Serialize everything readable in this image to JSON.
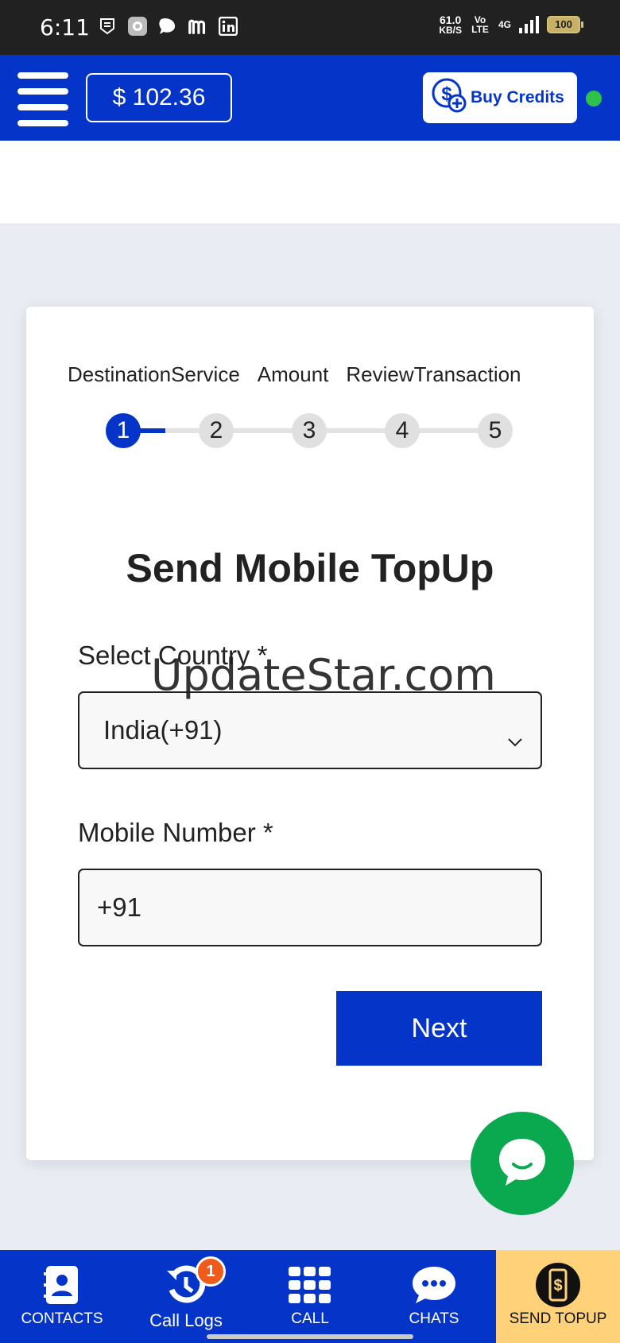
{
  "status_bar": {
    "time": "6:11",
    "network_speed": "61.0",
    "speed_unit": "KB/S",
    "volte": "Vo LTE",
    "network": "4G",
    "battery": "100"
  },
  "header": {
    "balance": "$ 102.36",
    "buy_credits_label": "Buy Credits",
    "accent_color": "#0534c9",
    "online_color": "#2ec24a"
  },
  "stepper": {
    "labels": [
      "Destination",
      "Service",
      "Amount",
      "Review",
      "Transaction"
    ],
    "steps": [
      "1",
      "2",
      "3",
      "4",
      "5"
    ],
    "active_step": 1
  },
  "form": {
    "title": "Send Mobile TopUp",
    "country_label": "Select Country *",
    "country_value": "India(+91)",
    "mobile_label": "Mobile Number *",
    "mobile_value": "+91",
    "next_label": "Next"
  },
  "watermark": "UpdateStar.com",
  "bottom_nav": {
    "items": [
      {
        "label": "CONTACTS",
        "icon": "contacts-icon"
      },
      {
        "label": "Call Logs",
        "icon": "call-logs-icon",
        "badge": "1"
      },
      {
        "label": "CALL",
        "icon": "dialpad-icon"
      },
      {
        "label": "CHATS",
        "icon": "chat-bubble-icon"
      },
      {
        "label": "SEND TOPUP",
        "icon": "send-topup-icon"
      }
    ],
    "highlight_color": "#ffd27a"
  }
}
